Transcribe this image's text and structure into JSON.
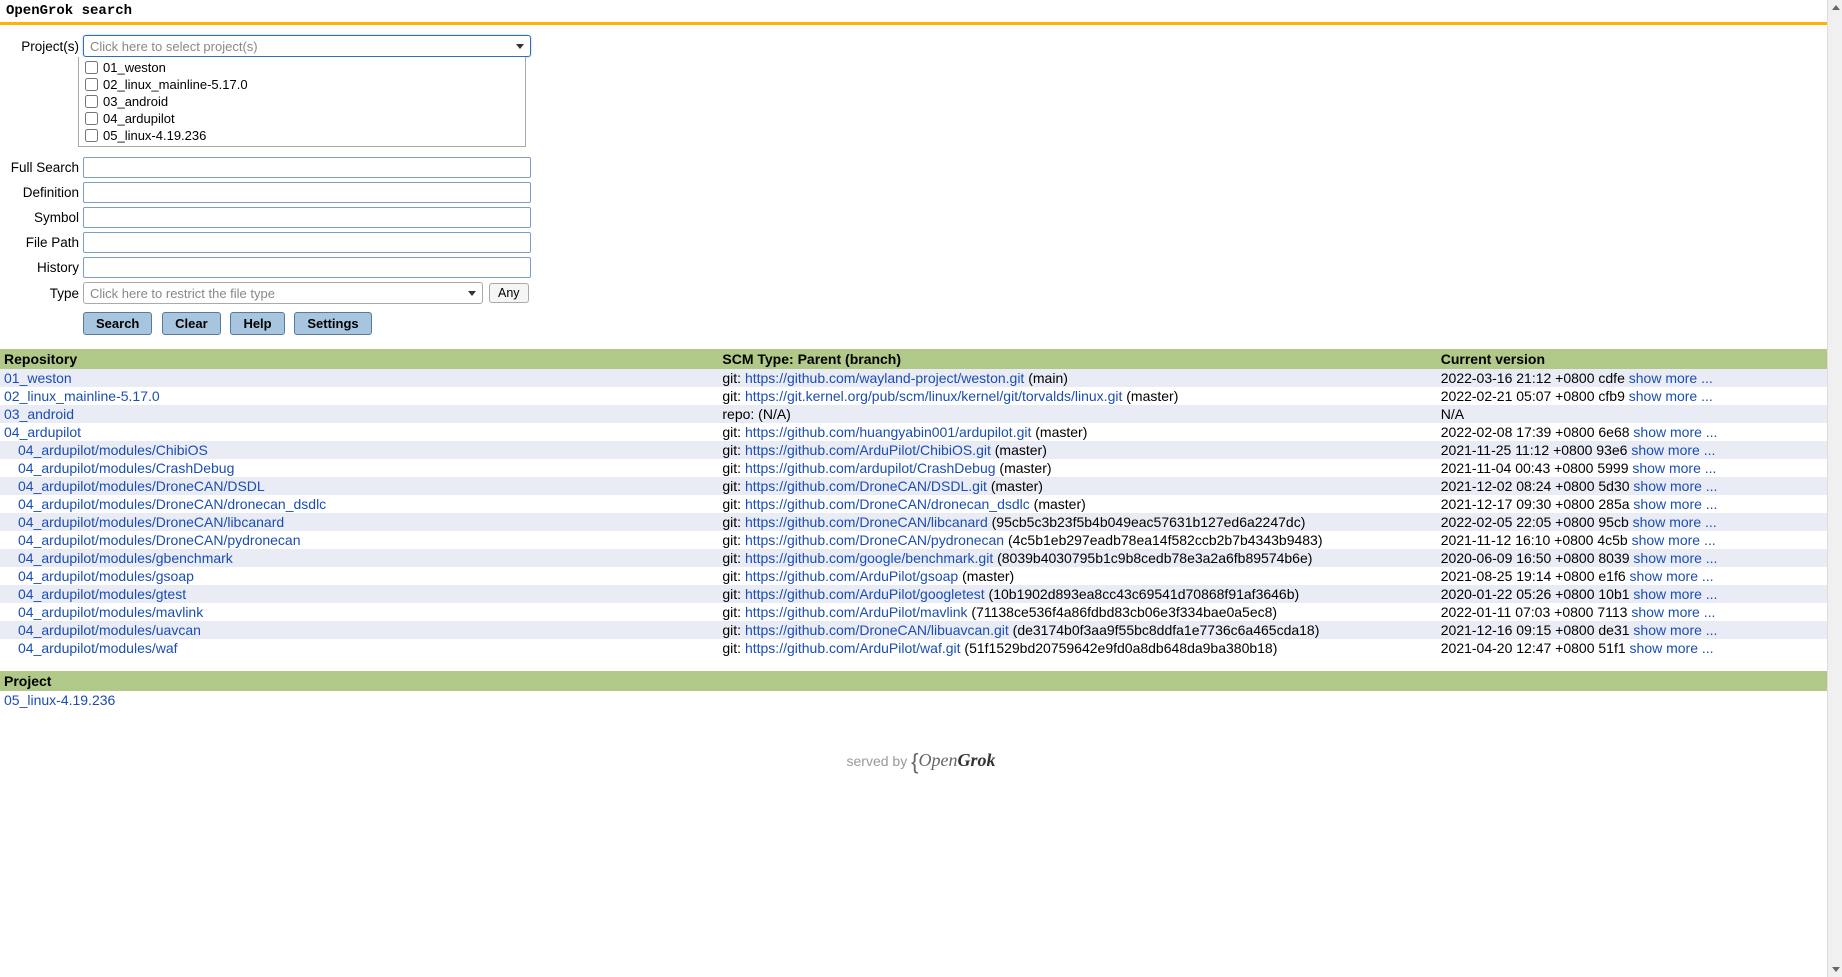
{
  "page_title": "OpenGrok search",
  "form": {
    "labels": {
      "projects": "Project(s)",
      "full_search": "Full Search",
      "definition": "Definition",
      "symbol": "Symbol",
      "file_path": "File Path",
      "history": "History",
      "type": "Type"
    },
    "project_placeholder": "Click here to select project(s)",
    "project_options": [
      "01_weston",
      "02_linux_mainline-5.17.0",
      "03_android",
      "04_ardupilot",
      "05_linux-4.19.236"
    ],
    "type_placeholder": "Click here to restrict the file type",
    "any_label": "Any",
    "buttons": {
      "search": "Search",
      "clear": "Clear",
      "help": "Help",
      "settings": "Settings"
    }
  },
  "table": {
    "headers": {
      "repo": "Repository",
      "scm": "SCM Type: Parent (branch)",
      "ver": "Current version"
    },
    "rows": [
      {
        "indent": 0,
        "name": "01_weston",
        "scm_prefix": "git: ",
        "url": "https://github.com/wayland-project/weston.git",
        "branch": " (main)",
        "ver": "2022-03-16 21:12 +0800 cdfe ",
        "more": "show more ..."
      },
      {
        "indent": 0,
        "name": "02_linux_mainline-5.17.0",
        "scm_prefix": "git: ",
        "url": "https://git.kernel.org/pub/scm/linux/kernel/git/torvalds/linux.git",
        "branch": " (master)",
        "ver": "2022-02-21 05:07 +0800 cfb9 ",
        "more": "show more ..."
      },
      {
        "indent": 0,
        "name": "03_android",
        "scm_prefix": "repo: (N/A)",
        "url": "",
        "branch": "",
        "ver": "N/A",
        "more": ""
      },
      {
        "indent": 0,
        "name": "04_ardupilot",
        "scm_prefix": "git: ",
        "url": "https://github.com/huangyabin001/ardupilot.git",
        "branch": " (master)",
        "ver": "2022-02-08 17:39 +0800 6e68 ",
        "more": "show more ..."
      },
      {
        "indent": 1,
        "name": "04_ardupilot/modules/ChibiOS",
        "scm_prefix": "git: ",
        "url": "https://github.com/ArduPilot/ChibiOS.git",
        "branch": " (master)",
        "ver": "2021-11-25 11:12 +0800 93e6 ",
        "more": "show more ..."
      },
      {
        "indent": 1,
        "name": "04_ardupilot/modules/CrashDebug",
        "scm_prefix": "git: ",
        "url": "https://github.com/ardupilot/CrashDebug",
        "branch": " (master)",
        "ver": "2021-11-04 00:43 +0800 5999 ",
        "more": "show more ..."
      },
      {
        "indent": 1,
        "name": "04_ardupilot/modules/DroneCAN/DSDL",
        "scm_prefix": "git: ",
        "url": "https://github.com/DroneCAN/DSDL.git",
        "branch": " (master)",
        "ver": "2021-12-02 08:24 +0800 5d30 ",
        "more": "show more ..."
      },
      {
        "indent": 1,
        "name": "04_ardupilot/modules/DroneCAN/dronecan_dsdlc",
        "scm_prefix": "git: ",
        "url": "https://github.com/DroneCAN/dronecan_dsdlc",
        "branch": " (master)",
        "ver": "2021-12-17 09:30 +0800 285a ",
        "more": "show more ..."
      },
      {
        "indent": 1,
        "name": "04_ardupilot/modules/DroneCAN/libcanard",
        "scm_prefix": "git: ",
        "url": "https://github.com/DroneCAN/libcanard",
        "branch": " (95cb5c3b23f5b4b049eac57631b127ed6a2247dc)",
        "ver": "2022-02-05 22:05 +0800 95cb ",
        "more": "show more ..."
      },
      {
        "indent": 1,
        "name": "04_ardupilot/modules/DroneCAN/pydronecan",
        "scm_prefix": "git: ",
        "url": "https://github.com/DroneCAN/pydronecan",
        "branch": " (4c5b1eb297eadb78ea14f582ccb2b7b4343b9483)",
        "ver": "2021-11-12 16:10 +0800 4c5b ",
        "more": "show more ..."
      },
      {
        "indent": 1,
        "name": "04_ardupilot/modules/gbenchmark",
        "scm_prefix": "git: ",
        "url": "https://github.com/google/benchmark.git",
        "branch": " (8039b4030795b1c9b8cedb78e3a2a6fb89574b6e)",
        "ver": "2020-06-09 16:50 +0800 8039 ",
        "more": "show more ..."
      },
      {
        "indent": 1,
        "name": "04_ardupilot/modules/gsoap",
        "scm_prefix": "git: ",
        "url": "https://github.com/ArduPilot/gsoap",
        "branch": " (master)",
        "ver": "2021-08-25 19:14 +0800 e1f6 ",
        "more": "show more ..."
      },
      {
        "indent": 1,
        "name": "04_ardupilot/modules/gtest",
        "scm_prefix": "git: ",
        "url": "https://github.com/ArduPilot/googletest",
        "branch": " (10b1902d893ea8cc43c69541d70868f91af3646b)",
        "ver": "2020-01-22 05:26 +0800 10b1 ",
        "more": "show more ..."
      },
      {
        "indent": 1,
        "name": "04_ardupilot/modules/mavlink",
        "scm_prefix": "git: ",
        "url": "https://github.com/ArduPilot/mavlink",
        "branch": " (71138ce536f4a86fdbd83cb06e3f334bae0a5ec8)",
        "ver": "2022-01-11 07:03 +0800 7113 ",
        "more": "show more ..."
      },
      {
        "indent": 1,
        "name": "04_ardupilot/modules/uavcan",
        "scm_prefix": "git: ",
        "url": "https://github.com/DroneCAN/libuavcan.git",
        "branch": " (de3174b0f3aa9f55bc8ddfa1e7736c6a465cda18)",
        "ver": "2021-12-16 09:15 +0800 de31 ",
        "more": "show more ..."
      },
      {
        "indent": 1,
        "name": "04_ardupilot/modules/waf",
        "scm_prefix": "git: ",
        "url": "https://github.com/ArduPilot/waf.git",
        "branch": " (51f1529bd20759642e9fd0a8db648da9ba380b18)",
        "ver": "2021-04-20 12:47 +0800 51f1 ",
        "more": "show more ..."
      }
    ]
  },
  "project_section": {
    "header": "Project",
    "items": [
      "05_linux-4.19.236"
    ]
  },
  "footer": {
    "served_by": "served by ",
    "brand_open": "Open",
    "brand_grok": "Grok"
  }
}
